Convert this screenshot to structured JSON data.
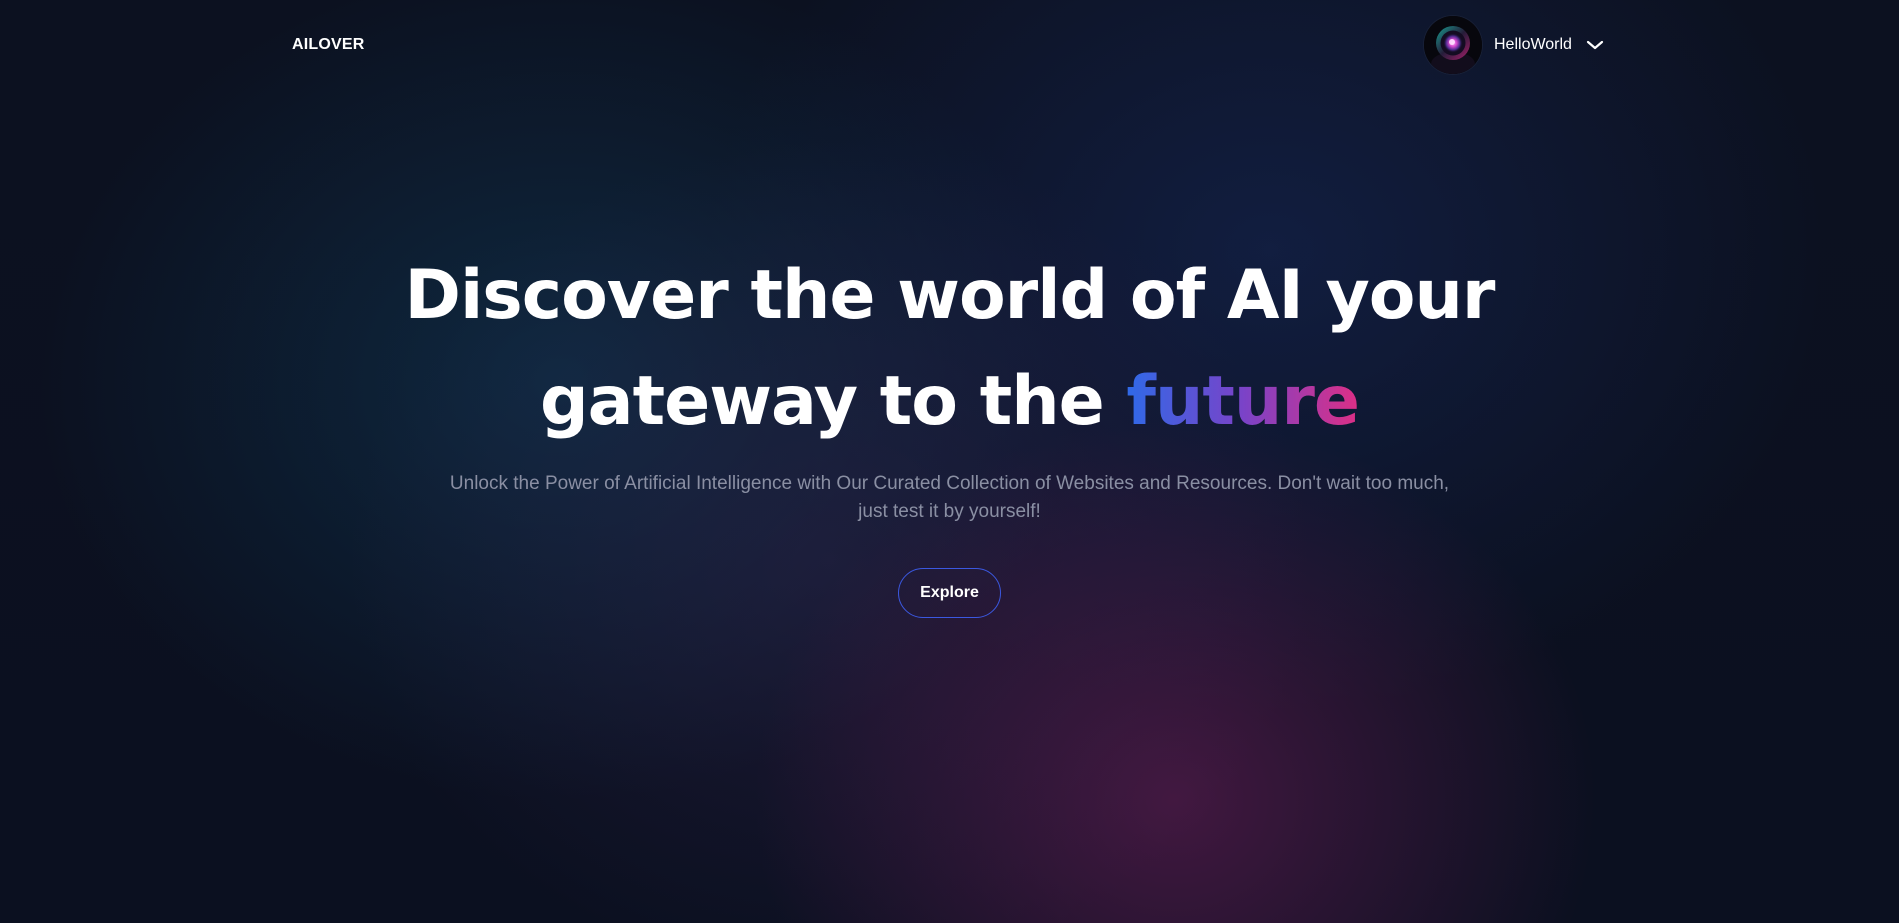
{
  "navbar": {
    "logo": "AILOVER",
    "user": {
      "name": "HelloWorld",
      "avatar_icon": "astronaut-avatar-icon",
      "menu_icon": "chevron-down-icon"
    }
  },
  "hero": {
    "title_line1": "Discover the world of AI your",
    "title_line2_prefix": "gateway to the ",
    "title_highlight": "future",
    "subtitle": "Unlock the Power of Artificial Intelligence with Our Curated Collection of Websites and Resources. Don't wait too much, just test it by yourself!",
    "cta_label": "Explore"
  },
  "colors": {
    "background": "#0c1120",
    "accent_gradient": [
      "#2f6ae8",
      "#7a43c8",
      "#dd2f86"
    ],
    "button_border": "#3b58e0",
    "subtitle_text": "#8a8fa3"
  }
}
